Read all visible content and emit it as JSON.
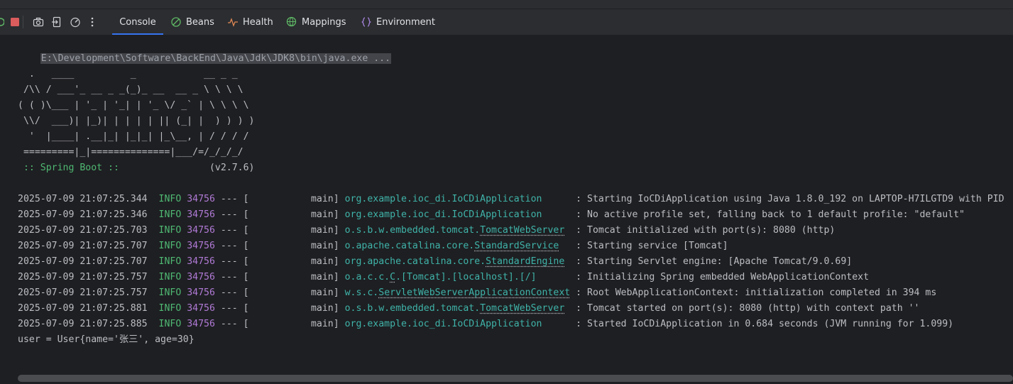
{
  "top_fragment": "",
  "toolbar": {
    "tabs": [
      {
        "label": "Console",
        "icon": "none"
      },
      {
        "label": "Beans",
        "icon": "beans-icon"
      },
      {
        "label": "Health",
        "icon": "health-icon"
      },
      {
        "label": "Mappings",
        "icon": "mappings-icon"
      },
      {
        "label": "Environment",
        "icon": "environment-icon"
      }
    ]
  },
  "colors": {
    "background": "#1e1f22",
    "toolbar": "#2b2d30",
    "text": "#bcbec4",
    "info_green": "#4fb873",
    "pid_purple": "#b07ad6",
    "logger_teal": "#3fb3a9",
    "tab_underline": "#3574f0"
  },
  "console": {
    "command": "E:\\Development\\Software\\BackEnd\\Java\\Jdk\\JDK8\\bin\\java.exe ...",
    "banner": [
      "  .   ____          _            __ _ _",
      " /\\\\ / ___'_ __ _ _(_)_ __  __ _ \\ \\ \\ \\",
      "( ( )\\___ | '_ | '_| | '_ \\/ _` | \\ \\ \\ \\",
      " \\\\/  ___)| |_)| | | | | || (_| |  ) ) ) )",
      "  '  |____| .__|_| |_|_| |_\\__, | / / / /",
      " =========|_|==============|___/=/_/_/_/"
    ],
    "spring_label": " :: Spring Boot :: ",
    "spring_version": "(v2.7.6)",
    "logs": [
      {
        "ts": "2025-07-09 21:07:25.344",
        "level": "INFO",
        "pid": "34756",
        "sep": "---",
        "thread": "[           main]",
        "logger_pre": "org.example.ioc_di.IoCDiApplication",
        "logger_ul": "",
        "logger_post": "",
        "msg": ": Starting IoCDiApplication using Java 1.8.0_192 on LAPTOP-H7ILGTD9 with PID"
      },
      {
        "ts": "2025-07-09 21:07:25.346",
        "level": "INFO",
        "pid": "34756",
        "sep": "---",
        "thread": "[           main]",
        "logger_pre": "org.example.ioc_di.IoCDiApplication",
        "logger_ul": "",
        "logger_post": "",
        "msg": ": No active profile set, falling back to 1 default profile: \"default\""
      },
      {
        "ts": "2025-07-09 21:07:25.703",
        "level": "INFO",
        "pid": "34756",
        "sep": "---",
        "thread": "[           main]",
        "logger_pre": "o.s.b.w.embedded.tomcat.",
        "logger_ul": "TomcatWebServer",
        "logger_post": "",
        "msg": ": Tomcat initialized with port(s): 8080 (http)"
      },
      {
        "ts": "2025-07-09 21:07:25.707",
        "level": "INFO",
        "pid": "34756",
        "sep": "---",
        "thread": "[           main]",
        "logger_pre": "o.apache.catalina.core.",
        "logger_ul": "StandardService",
        "logger_post": "",
        "msg": ": Starting service [Tomcat]"
      },
      {
        "ts": "2025-07-09 21:07:25.707",
        "level": "INFO",
        "pid": "34756",
        "sep": "---",
        "thread": "[           main]",
        "logger_pre": "org.apache.catalina.core.",
        "logger_ul": "StandardEngine",
        "logger_post": "",
        "msg": ": Starting Servlet engine: [Apache Tomcat/9.0.69]"
      },
      {
        "ts": "2025-07-09 21:07:25.757",
        "level": "INFO",
        "pid": "34756",
        "sep": "---",
        "thread": "[           main]",
        "logger_pre": "o.a.c.c.",
        "logger_ul": "C",
        "logger_post": ".[Tomcat].[localhost].[/]",
        "msg": ": Initializing Spring embedded WebApplicationContext"
      },
      {
        "ts": "2025-07-09 21:07:25.757",
        "level": "INFO",
        "pid": "34756",
        "sep": "---",
        "thread": "[           main]",
        "logger_pre": "w.s.c.",
        "logger_ul": "ServletWebServerApplicationContext",
        "logger_post": "",
        "msg": ": Root WebApplicationContext: initialization completed in 394 ms"
      },
      {
        "ts": "2025-07-09 21:07:25.881",
        "level": "INFO",
        "pid": "34756",
        "sep": "---",
        "thread": "[           main]",
        "logger_pre": "o.s.b.w.embedded.tomcat.",
        "logger_ul": "TomcatWebServer",
        "logger_post": "",
        "msg": ": Tomcat started on port(s): 8080 (http) with context path ''"
      },
      {
        "ts": "2025-07-09 21:07:25.885",
        "level": "INFO",
        "pid": "34756",
        "sep": "---",
        "thread": "[           main]",
        "logger_pre": "org.example.ioc_di.IoCDiApplication",
        "logger_ul": "",
        "logger_post": "",
        "msg": ": Started IoCDiApplication in 0.684 seconds (JVM running for 1.099)"
      }
    ],
    "output": "user = User{name='张三', age=30}"
  }
}
